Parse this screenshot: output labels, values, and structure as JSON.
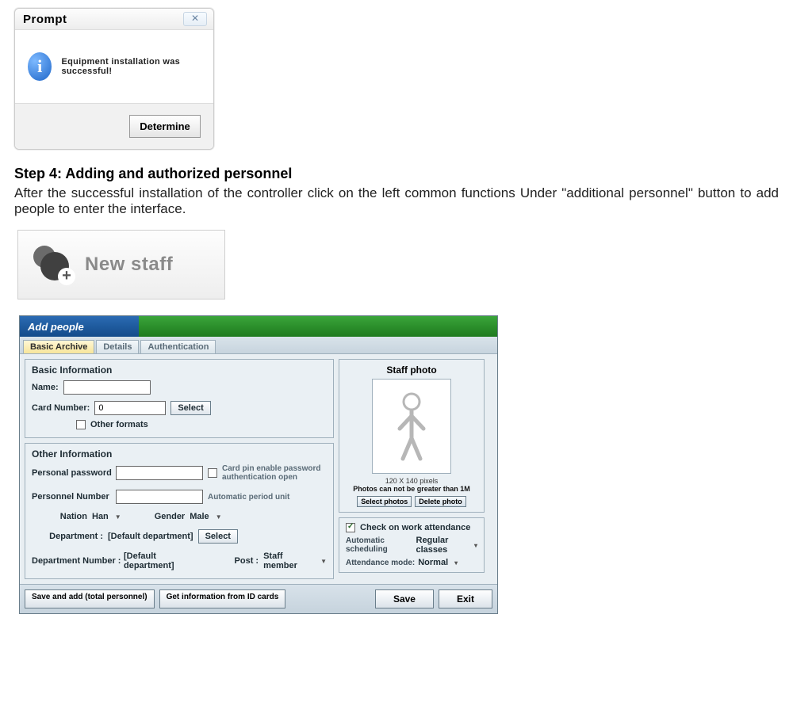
{
  "prompt": {
    "title": "Prompt",
    "message": "Equipment installation was successful!",
    "ok": "Determine",
    "close": "✕"
  },
  "step": {
    "heading": "Step 4: Adding and authorized personnel",
    "paragraph": "After the successful installation of the controller click on the left common functions Under \"additional personnel\" button to add people to enter the interface."
  },
  "newstaff": {
    "label": "New staff"
  },
  "addpeople": {
    "title": "Add people",
    "tabs": {
      "basic": "Basic Archive",
      "details": "Details",
      "authentication": "Authentication"
    },
    "basic_info": {
      "section": "Basic Information",
      "name_label": "Name:",
      "name_value": "",
      "card_label": "Card Number:",
      "card_value": "0",
      "select_btn": "Select",
      "other_formats": "Other formats"
    },
    "other_info": {
      "section": "Other Information",
      "personal_password_label": "Personal password",
      "personal_password_value": "",
      "card_pin_enable": "Card pin enable password authentication open",
      "personnel_number_label": "Personnel Number",
      "personnel_number_value": "",
      "auto_period_note": "Automatic period unit",
      "nation_label": "Nation",
      "nation_value": "Han",
      "gender_label": "Gender",
      "gender_value": "Male",
      "department_label": "Department :",
      "department_value": "[Default department]",
      "dept_select_btn": "Select",
      "dept_number_label": "Department Number :",
      "dept_number_value": "[Default department]",
      "post_label": "Post :",
      "post_value": "Staff member"
    },
    "photo": {
      "section": "Staff photo",
      "note1": "120 X 140 pixels",
      "note2": "Photos can not be greater than 1M",
      "select_btn": "Select photos",
      "delete_btn": "Delete photo"
    },
    "attendance": {
      "check_label": "Check on work attendance",
      "auto_label": "Automatic scheduling",
      "auto_value": "Regular classes",
      "mode_label": "Attendance mode:",
      "mode_value": "Normal"
    },
    "footer": {
      "save_add": "Save and add (total personnel)",
      "get_id": "Get information from ID cards",
      "save": "Save",
      "exit": "Exit"
    }
  }
}
